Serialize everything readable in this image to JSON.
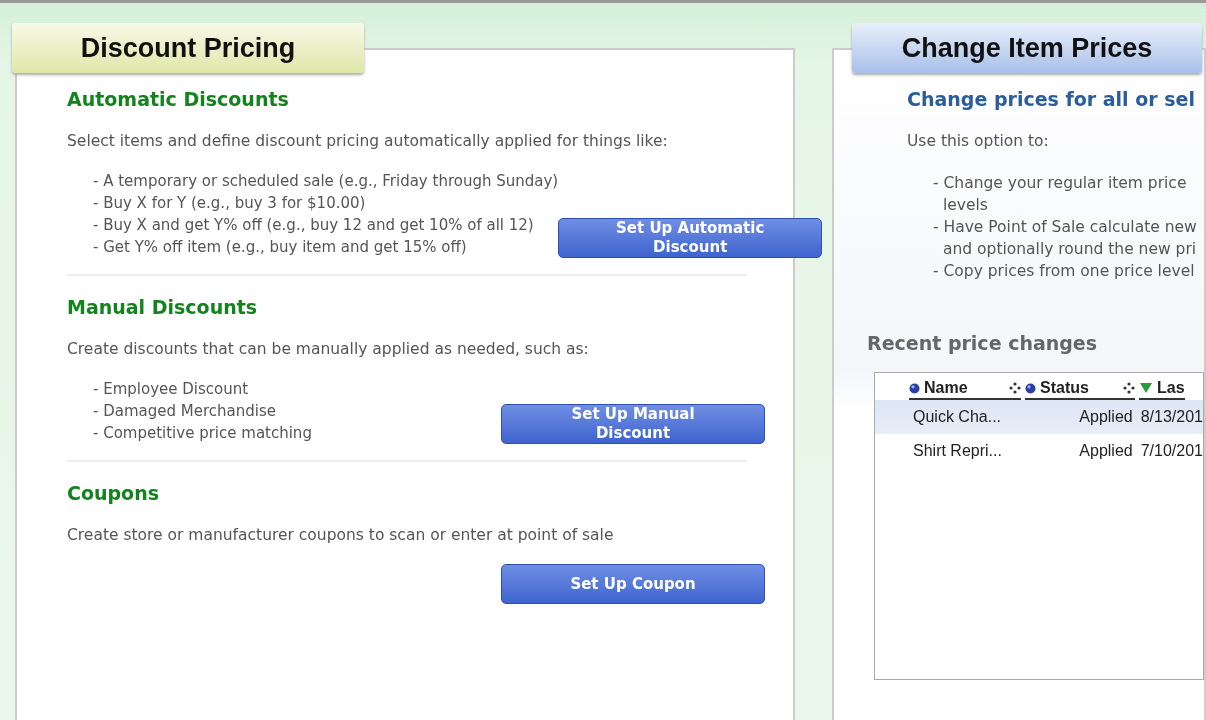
{
  "discount_panel": {
    "title": "Discount Pricing",
    "sections": [
      {
        "heading": "Automatic Discounts",
        "description": "Select items and define discount pricing automatically applied for things like:",
        "bullets": [
          "- A temporary or scheduled sale (e.g., Friday through Sunday)",
          "- Buy X for Y (e.g., buy 3 for $10.00)",
          "- Buy X and get Y% off (e.g., buy 12 and get 10% of all 12)",
          "- Get Y% off item (e.g., buy item and get 15% off)"
        ],
        "button": "Set Up Automatic Discount"
      },
      {
        "heading": "Manual Discounts",
        "description": "Create discounts that can be manually applied as needed, such as:",
        "bullets": [
          "- Employee Discount",
          "- Damaged Merchandise",
          "- Competitive price matching"
        ],
        "button": "Set Up Manual Discount"
      },
      {
        "heading": "Coupons",
        "description": "Create store or manufacturer coupons to scan or enter at point of sale",
        "button": "Set Up Coupon"
      }
    ]
  },
  "change_prices_panel": {
    "title": "Change Item Prices",
    "heading": "Change prices for all or sel",
    "description": "Use this option to:",
    "bullets": [
      "- Change your regular item price",
      "levels",
      "- Have Point of Sale calculate new",
      "and optionally round the new pri",
      "- Copy prices from one price level"
    ],
    "recent": {
      "title": "Recent price changes",
      "columns": [
        "Name",
        "Status",
        "Las"
      ],
      "rows": [
        {
          "cells": [
            "Quick Cha...",
            "Applied",
            "8/13/201"
          ],
          "selected": true
        },
        {
          "cells": [
            "Shirt Repri...",
            "Applied",
            "7/10/201"
          ],
          "selected": false
        }
      ]
    }
  }
}
